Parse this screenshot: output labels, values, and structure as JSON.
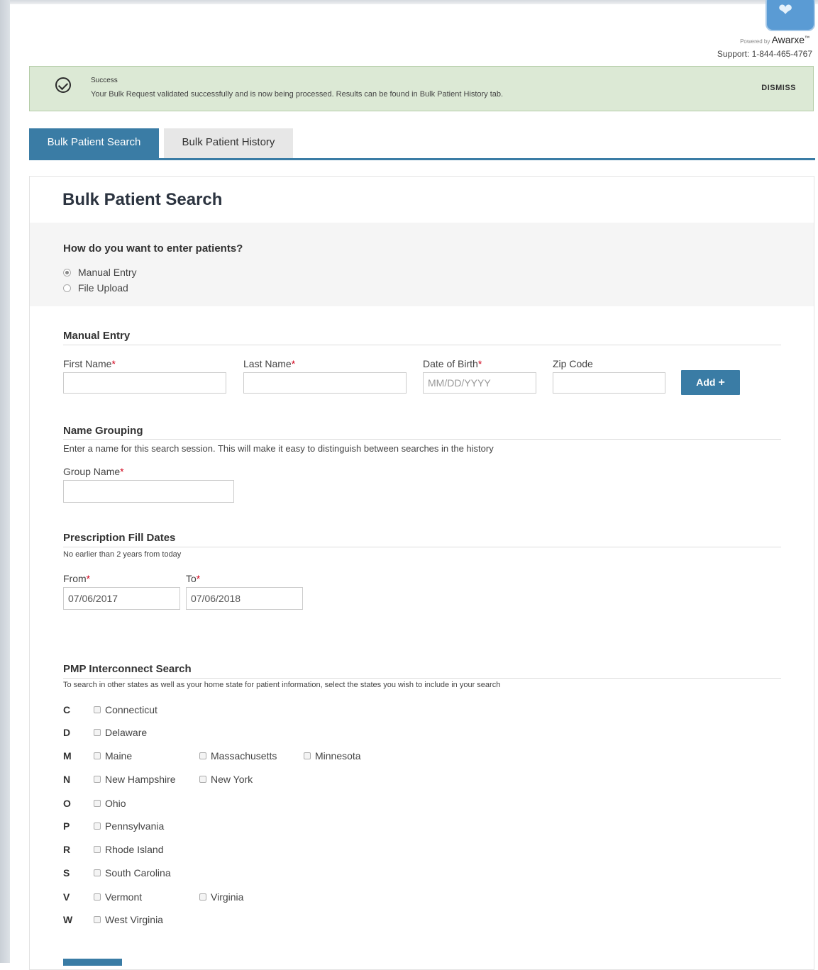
{
  "header": {
    "logo_text": "❤",
    "powered_by": "Powered by",
    "brand": "Awarxe",
    "brand_tm": "™",
    "support": "Support: 1-844-465-4767"
  },
  "alert": {
    "title": "Success",
    "message": "Your Bulk Request validated successfully and is now being processed. Results can be found in Bulk Patient History tab.",
    "dismiss": "DISMISS",
    "color": "#dce9d5"
  },
  "tabs": [
    {
      "label": "Bulk Patient Search",
      "active": true
    },
    {
      "label": "Bulk Patient History",
      "active": false
    }
  ],
  "page": {
    "title": "Bulk Patient Search",
    "question": "How do you want to enter patients?",
    "options": [
      {
        "label": "Manual Entry",
        "selected": true
      },
      {
        "label": "File Upload",
        "selected": false
      }
    ]
  },
  "manual_entry": {
    "heading": "Manual Entry",
    "first_name_label": "First Name",
    "last_name_label": "Last Name",
    "dob_label": "Date of Birth",
    "dob_placeholder": "MM/DD/YYYY",
    "zip_label": "Zip Code",
    "required_mark": "*",
    "add_label": "Add",
    "add_icon": "+"
  },
  "name_grouping": {
    "heading": "Name Grouping",
    "help": "Enter a name for this search session. This will make it easy to distinguish between searches in the history",
    "group_name_label": "Group Name"
  },
  "fill_dates": {
    "heading": "Prescription Fill Dates",
    "help": "No earlier than 2 years from today",
    "from_label": "From",
    "from_value": "07/06/2017",
    "to_label": "To",
    "to_value": "07/06/2018"
  },
  "pmp": {
    "heading": "PMP Interconnect Search",
    "help": "To search in other states as well as your home state for patient information, select the states you wish to include in your search",
    "groups": [
      {
        "letter": "C",
        "states": [
          "Connecticut"
        ]
      },
      {
        "letter": "D",
        "states": [
          "Delaware"
        ]
      },
      {
        "letter": "M",
        "states": [
          "Maine",
          "Massachusetts",
          "Minnesota"
        ]
      },
      {
        "letter": "N",
        "states": [
          "New Hampshire",
          "New York"
        ]
      },
      {
        "letter": "O",
        "states": [
          "Ohio"
        ]
      },
      {
        "letter": "P",
        "states": [
          "Pennsylvania"
        ]
      },
      {
        "letter": "R",
        "states": [
          "Rhode Island"
        ]
      },
      {
        "letter": "S",
        "states": [
          "South Carolina"
        ]
      },
      {
        "letter": "V",
        "states": [
          "Vermont",
          "Virginia"
        ]
      },
      {
        "letter": "W",
        "states": [
          "West Virginia"
        ]
      }
    ]
  },
  "colors": {
    "primary": "#3a7ca5",
    "required": "#d0021b"
  }
}
